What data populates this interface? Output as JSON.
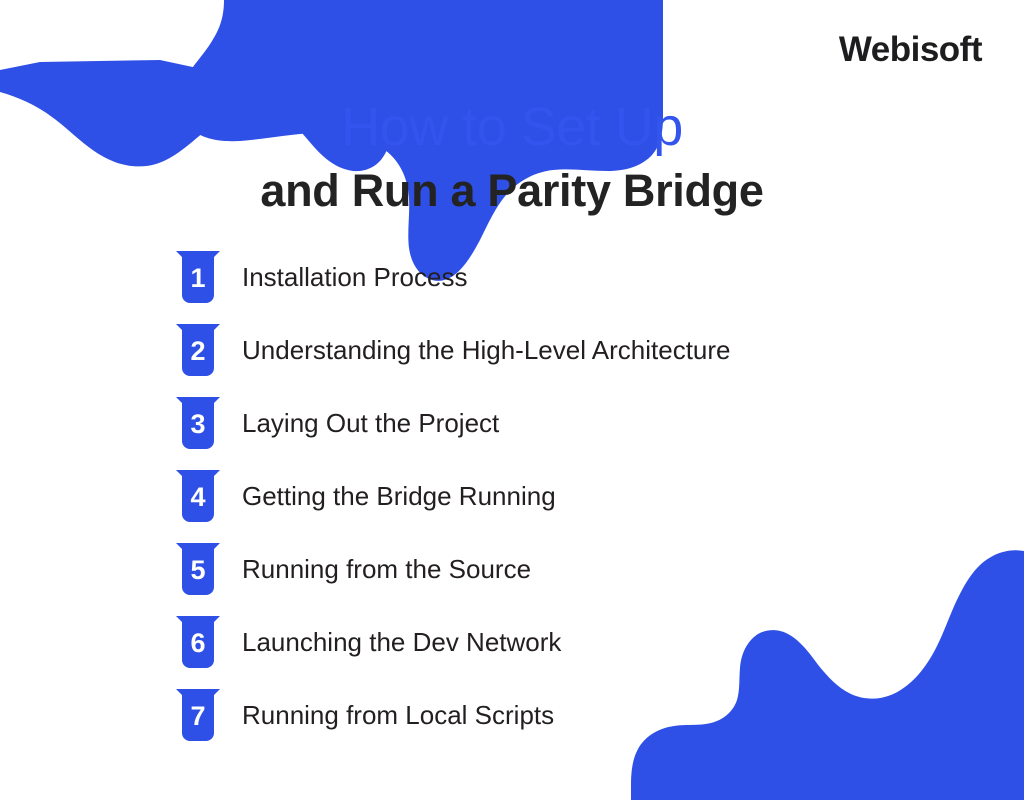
{
  "brand": {
    "name": "Webisoft"
  },
  "headline": {
    "line_1": "How to Set Up",
    "line_2": "and Run a Parity Bridge"
  },
  "steps": [
    {
      "number": "1",
      "label": "Installation Process"
    },
    {
      "number": "2",
      "label": "Understanding the High-Level Architecture"
    },
    {
      "number": "3",
      "label": "Laying Out the Project"
    },
    {
      "number": "4",
      "label": "Getting the Bridge Running"
    },
    {
      "number": "5",
      "label": "Running from the Source"
    },
    {
      "number": "6",
      "label": "Launching the Dev Network"
    },
    {
      "number": "7",
      "label": "Running from Local Scripts"
    }
  ],
  "colors": {
    "accent_blue": "#2f50e6",
    "headline_blue": "#3355ee",
    "headline_dark": "#232323",
    "body_text": "#231f20",
    "background": "#ffffff",
    "badge_text": "#ffffff"
  },
  "decoration": {
    "top_left_blob": "organic-blob-shape",
    "bottom_right_blob": "organic-wave-shape"
  }
}
